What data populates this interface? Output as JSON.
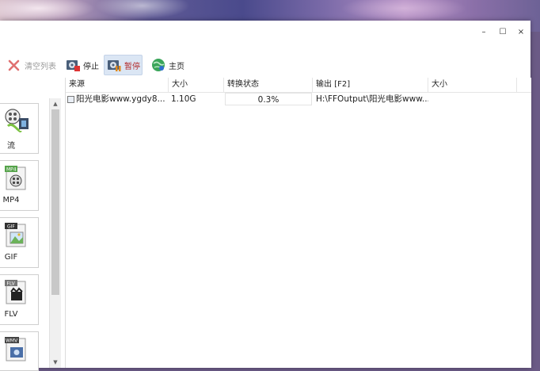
{
  "window": {
    "controls": {
      "minimize": "–",
      "maximize": "☐",
      "close": "×"
    }
  },
  "toolbar": {
    "clear_label": "清空列表",
    "stop_label": "停止",
    "pause_label": "暂停",
    "home_label": "主页"
  },
  "formats": [
    {
      "label": "流",
      "icon": "video-film-icon"
    },
    {
      "label": "MP4",
      "icon": "mp4-file-icon"
    },
    {
      "label": "GIF",
      "icon": "gif-file-icon"
    },
    {
      "label": "FLV",
      "icon": "flv-file-icon"
    },
    {
      "label": "WMV",
      "icon": "wmv-file-icon"
    }
  ],
  "table": {
    "columns": [
      "来源",
      "大小",
      "转换状态",
      "输出 [F2]",
      "大小"
    ],
    "rows": [
      {
        "source": "阳光电影www.ygdy8...",
        "size": "1.10G",
        "status": "0.3%",
        "output": "H:\\FFOutput\\阳光电影www...",
        "output_size": ""
      }
    ]
  },
  "colors": {
    "pause_highlight": "#dbe6f4",
    "pause_text": "#b22a2a",
    "disabled_text": "#9a9a9a"
  }
}
